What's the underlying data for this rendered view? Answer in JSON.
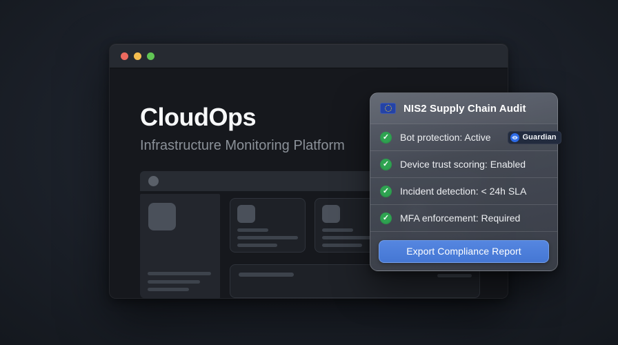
{
  "window": {
    "app_title": "CloudOps",
    "app_subtitle": "Infrastructure Monitoring Platform",
    "traffic_light_colors": {
      "close": "#ed6a5f",
      "minimize": "#f5bd4f",
      "zoom": "#61c554"
    }
  },
  "audit_card": {
    "title": "NIS2 Supply Chain Audit",
    "check_glyph": "✓",
    "check_color": "#2fa351",
    "accent_color": "#4a7cd6",
    "items": [
      {
        "label": "Bot protection: Active",
        "badge": {
          "icon": "eye-icon",
          "label": "Guardian"
        }
      },
      {
        "label": "Device trust scoring: Enabled"
      },
      {
        "label": "Incident detection: < 24h SLA"
      },
      {
        "label": "MFA enforcement: Required"
      }
    ],
    "button_label": "Export Compliance Report"
  }
}
